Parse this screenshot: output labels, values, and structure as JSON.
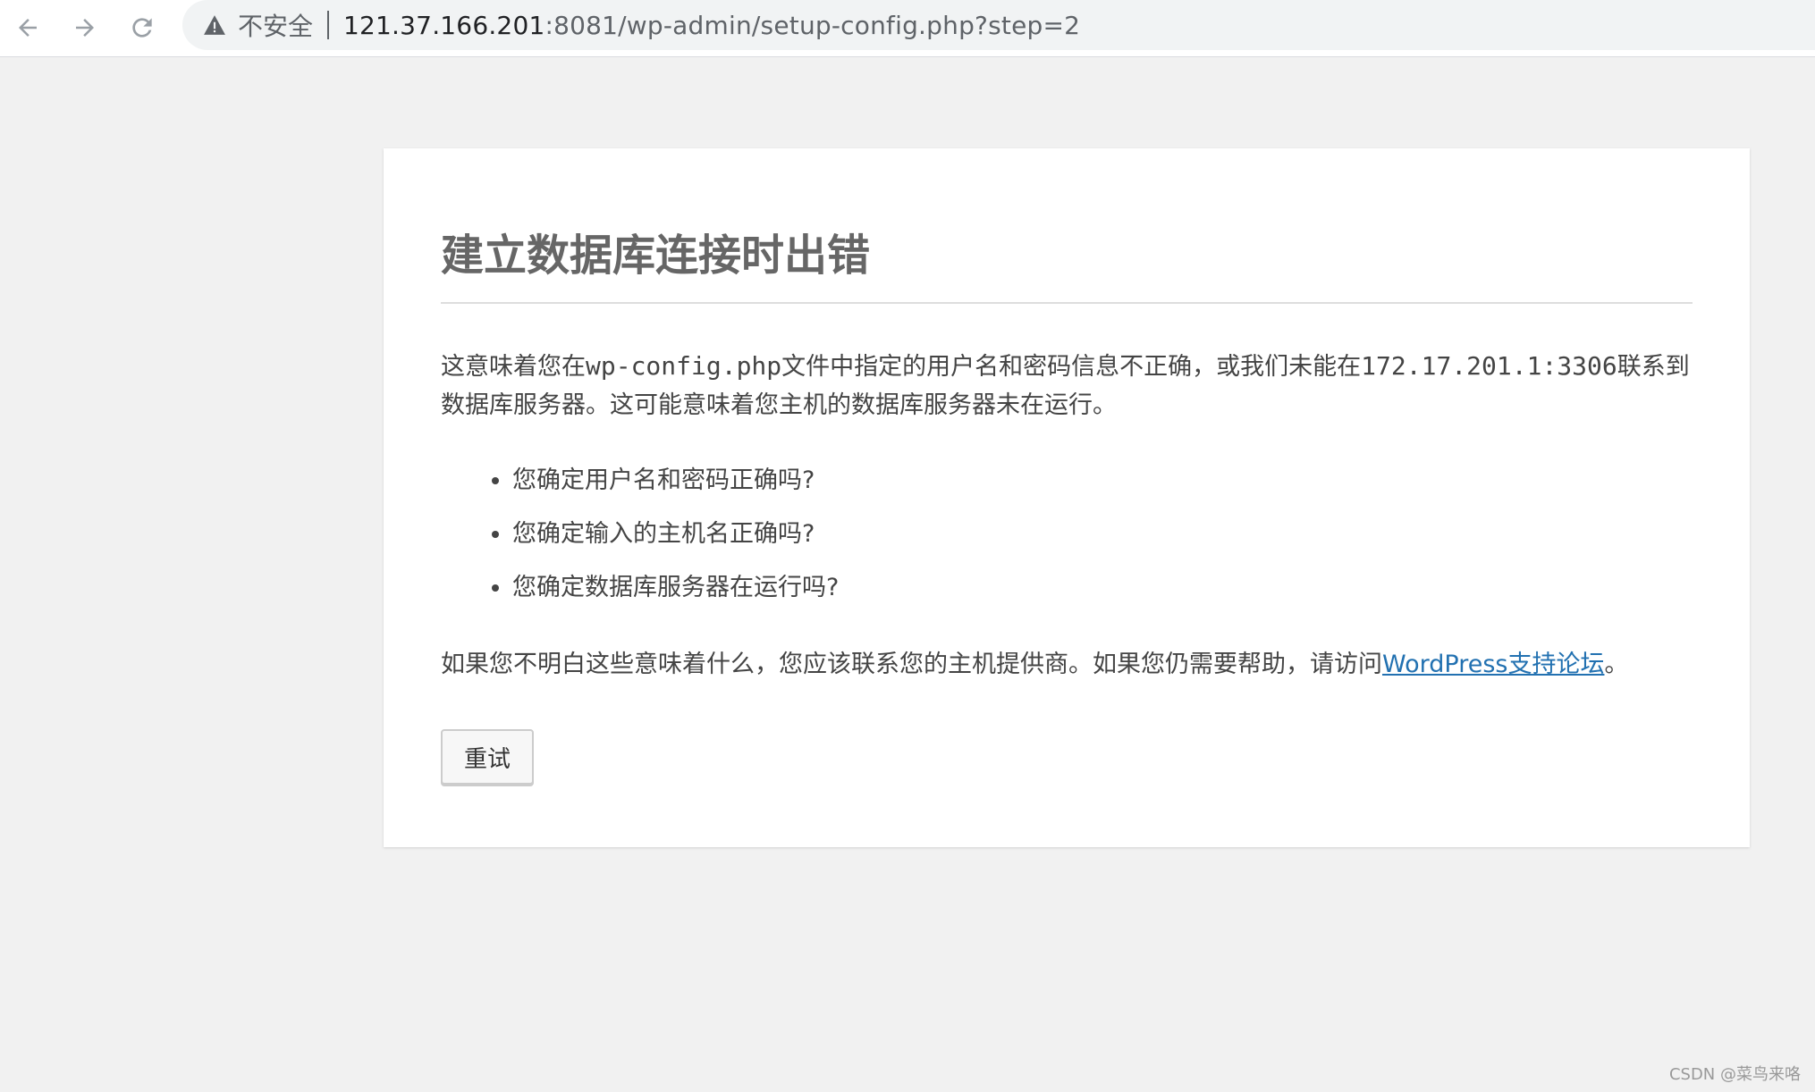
{
  "browser": {
    "back_icon": "arrow-left-icon",
    "forward_icon": "arrow-right-icon",
    "reload_icon": "reload-icon",
    "security_icon": "warning-triangle-icon",
    "security_label": "不安全",
    "url_host": "121.37.166.201",
    "url_rest": ":8081/wp-admin/setup-config.php?step=2"
  },
  "page": {
    "title": "建立数据库连接时出错",
    "intro_part1": "这意味着您在",
    "intro_code1": "wp-config.php",
    "intro_part2": "文件中指定的用户名和密码信息不正确，或我们未能在",
    "intro_code2": "172.17.201.1:3306",
    "intro_part3": "联系到数据库服务器。这可能意味着您主机的数据库服务器未在运行。",
    "checklist": [
      "您确定用户名和密码正确吗?",
      "您确定输入的主机名正确吗?",
      "您确定数据库服务器在运行吗?"
    ],
    "help_part1": "如果您不明白这些意味着什么，您应该联系您的主机提供商。如果您仍需要帮助，请访问",
    "help_link": "WordPress支持论坛",
    "help_part2": "。",
    "retry_label": "重试"
  },
  "watermark": "CSDN @菜鸟来咯",
  "colors": {
    "background": "#f1f1f1",
    "title": "#666666",
    "text": "#444444",
    "link": "#2271b1"
  }
}
